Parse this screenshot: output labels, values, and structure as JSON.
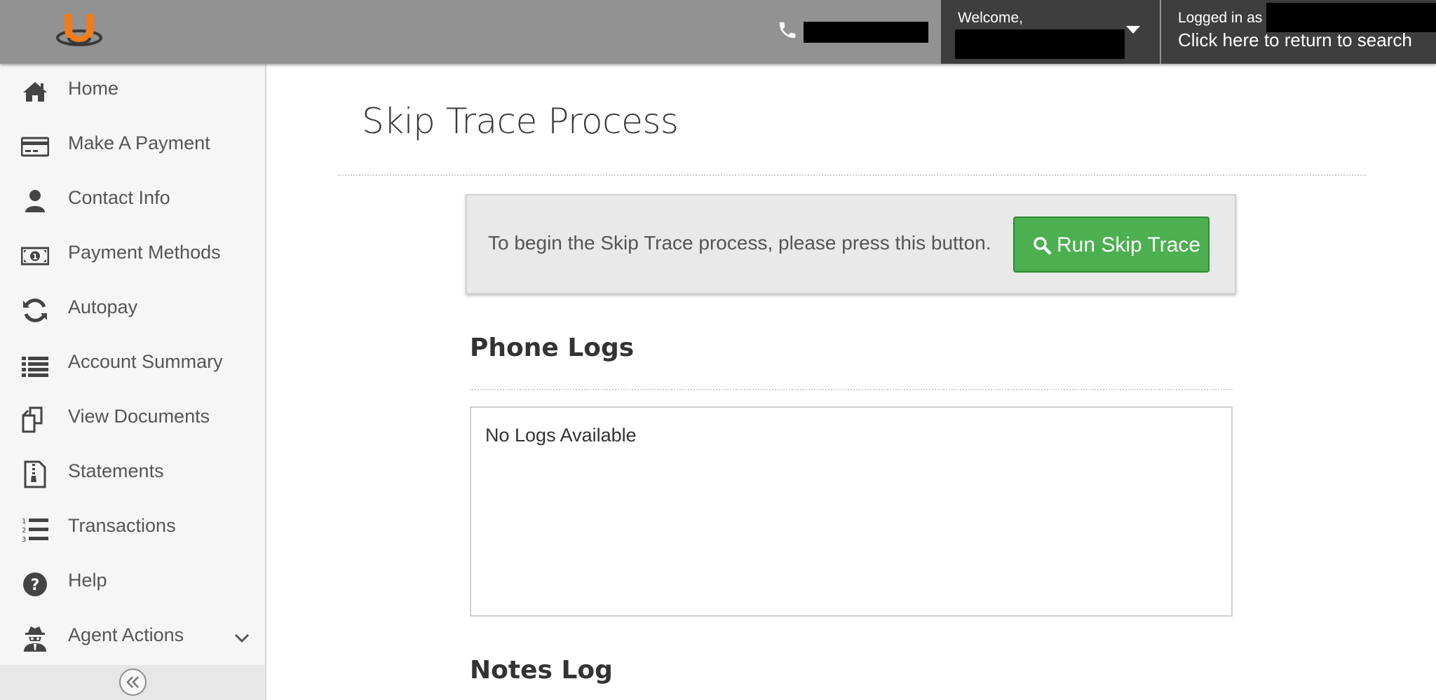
{
  "header": {
    "logo": "u-logo-icon",
    "phone_icon": "phone-icon",
    "welcome_label": "Welcome,",
    "logged_in_label": "Logged in as",
    "return_link": "Click here to return to search"
  },
  "sidebar": {
    "items": [
      {
        "label": "Home",
        "icon": "home-icon"
      },
      {
        "label": "Make A Payment",
        "icon": "credit-card-icon"
      },
      {
        "label": "Contact Info",
        "icon": "user-icon"
      },
      {
        "label": "Payment Methods",
        "icon": "money-icon"
      },
      {
        "label": "Autopay",
        "icon": "refresh-icon"
      },
      {
        "label": "Account Summary",
        "icon": "list-icon"
      },
      {
        "label": "View Documents",
        "icon": "documents-icon"
      },
      {
        "label": "Statements",
        "icon": "file-zip-icon"
      },
      {
        "label": "Transactions",
        "icon": "ordered-list-icon"
      },
      {
        "label": "Help",
        "icon": "help-icon"
      },
      {
        "label": "Agent Actions",
        "icon": "user-secret-icon"
      }
    ],
    "collapse_icon": "double-chevron-left-icon"
  },
  "main": {
    "title": "Skip Trace Process",
    "skip_prompt": "To begin the Skip Trace process, please press this button.",
    "skip_button": "Run Skip Trace",
    "phone_logs_title": "Phone Logs",
    "phone_logs_empty": "No Logs Available",
    "notes_log_title": "Notes Log"
  },
  "colors": {
    "header_bg": "#929292",
    "header_dark": "#3e3e3e",
    "accent_green": "#4caf50",
    "logo_orange": "#f07c1c"
  }
}
